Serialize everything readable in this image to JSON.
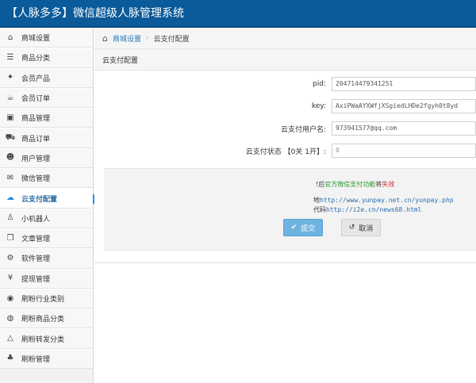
{
  "header": {
    "title": "【人脉多多】微信超级人脉管理系统"
  },
  "sidebar": {
    "items": [
      {
        "label": "商城设置",
        "icon": "home-icon",
        "glyph": "⌂"
      },
      {
        "label": "商品分类",
        "icon": "list-icon",
        "glyph": "☰"
      },
      {
        "label": "会员产品",
        "icon": "twitter-bird-icon",
        "glyph": "✦"
      },
      {
        "label": "会员订单",
        "icon": "coffee-cup-icon",
        "glyph": "☕"
      },
      {
        "label": "商品管理",
        "icon": "gift-icon",
        "glyph": "▣"
      },
      {
        "label": "商品订单",
        "icon": "truck-icon",
        "glyph": "⛟"
      },
      {
        "label": "用户管理",
        "icon": "users-icon",
        "glyph": "☻"
      },
      {
        "label": "微信管理",
        "icon": "chat-bubbles-icon",
        "glyph": "✉"
      },
      {
        "label": "云支付配置",
        "icon": "cloud-icon",
        "glyph": "☁"
      },
      {
        "label": "小机器人",
        "icon": "android-icon",
        "glyph": "♙"
      },
      {
        "label": "文章管理",
        "icon": "copy-icon",
        "glyph": "❐"
      },
      {
        "label": "软件管理",
        "icon": "gears-icon",
        "glyph": "⚙"
      },
      {
        "label": "提现管理",
        "icon": "yen-icon",
        "glyph": "¥"
      },
      {
        "label": "刷粉行业类别",
        "icon": "github-icon",
        "glyph": "◉"
      },
      {
        "label": "刷粉商品分类",
        "icon": "github-alt-icon",
        "glyph": "◍"
      },
      {
        "label": "刷粉转发分类",
        "icon": "linux-icon",
        "glyph": "△"
      },
      {
        "label": "刷粉管理",
        "icon": "sitemap-icon",
        "glyph": "♣"
      }
    ],
    "active_index": 8
  },
  "breadcrumb": {
    "home": "商城设置",
    "separator": "›",
    "current": "云支付配置"
  },
  "panel": {
    "title": "云支付配置",
    "fields": {
      "pid": {
        "label": "pid:",
        "value": "204714479341251"
      },
      "key": {
        "label": "key:",
        "value": "AxiPWaAYXWfjXSgiedLHDe2fgyh0t8yd"
      },
      "username": {
        "label": "云支付用户名:",
        "value": "973941577@qq.com"
      },
      "status": {
        "label": "云支付状态 【0关 1开】:",
        "value": "0"
      }
    },
    "notice": {
      "line1_prefix": "!后",
      "line1_green": "官方微信支付功能",
      "line1_mid": "将",
      "line1_red": "失效",
      "line2_prefix": "地",
      "line2_link": "http://www.yunpay.net.cn/yunpay.php",
      "line3_prefix": "代码",
      "line3_link": "http://i2e.cn/news68.html"
    },
    "buttons": {
      "submit": "提交",
      "cancel": "取消"
    }
  },
  "colors": {
    "header_bg": "#0b5a99",
    "active_accent": "#2e8ad8",
    "submit_bg": "#6fb3e0"
  }
}
